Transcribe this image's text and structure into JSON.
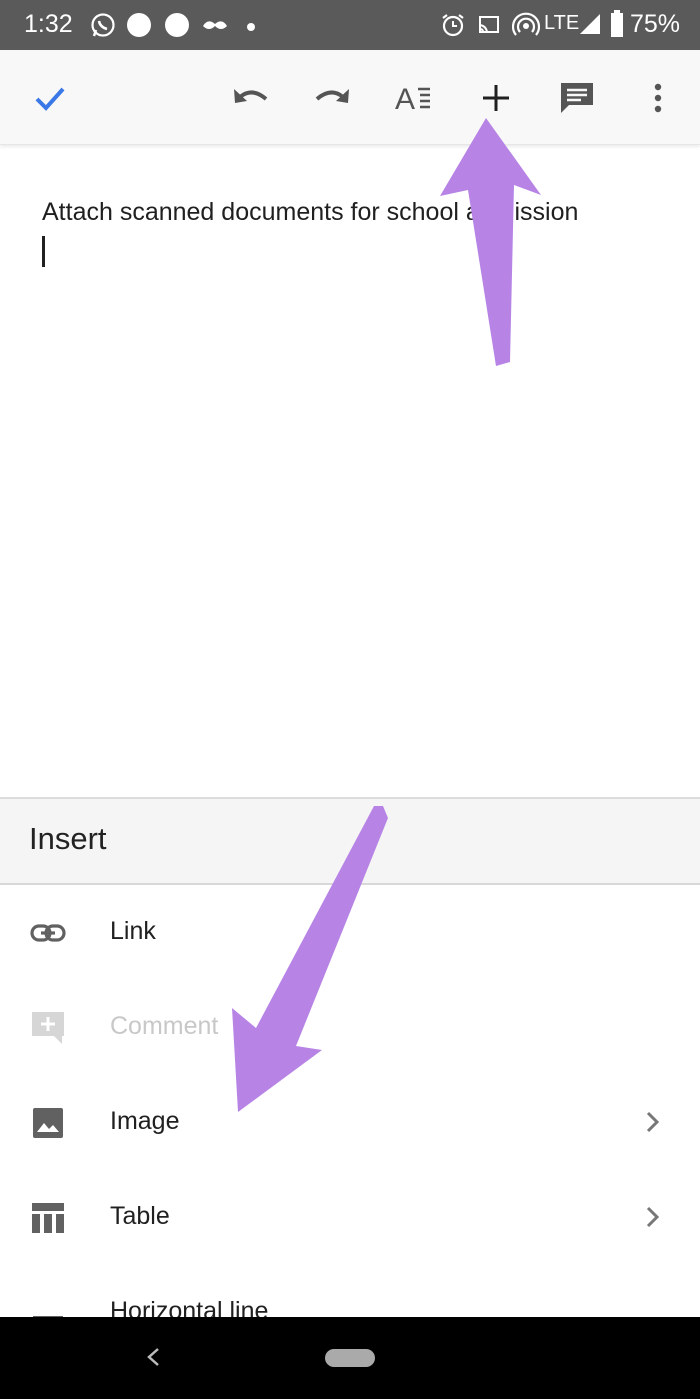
{
  "status_bar": {
    "time": "1:32",
    "network": "LTE",
    "battery": "75%"
  },
  "toolbar": {
    "icons": [
      "checkmark-icon",
      "undo-icon",
      "redo-icon",
      "text-format-icon",
      "plus-icon",
      "comment-icon",
      "more-vert-icon"
    ]
  },
  "document": {
    "text": "Attach scanned documents for school admission"
  },
  "insert_menu": {
    "title": "Insert",
    "items": [
      {
        "label": "Link",
        "icon": "link-icon",
        "enabled": true,
        "submenu": false
      },
      {
        "label": "Comment",
        "icon": "add-comment-icon",
        "enabled": false,
        "submenu": false
      },
      {
        "label": "Image",
        "icon": "image-icon",
        "enabled": true,
        "submenu": true
      },
      {
        "label": "Table",
        "icon": "table-icon",
        "enabled": true,
        "submenu": true
      },
      {
        "label": "Horizontal line",
        "icon": "horizontal-line-icon",
        "enabled": true,
        "submenu": false
      }
    ]
  },
  "colors": {
    "accent": "#3b78e7",
    "annotation_arrow": "#b784e6",
    "status_bar": "#5a5a5a",
    "nav_bar": "#000000"
  }
}
